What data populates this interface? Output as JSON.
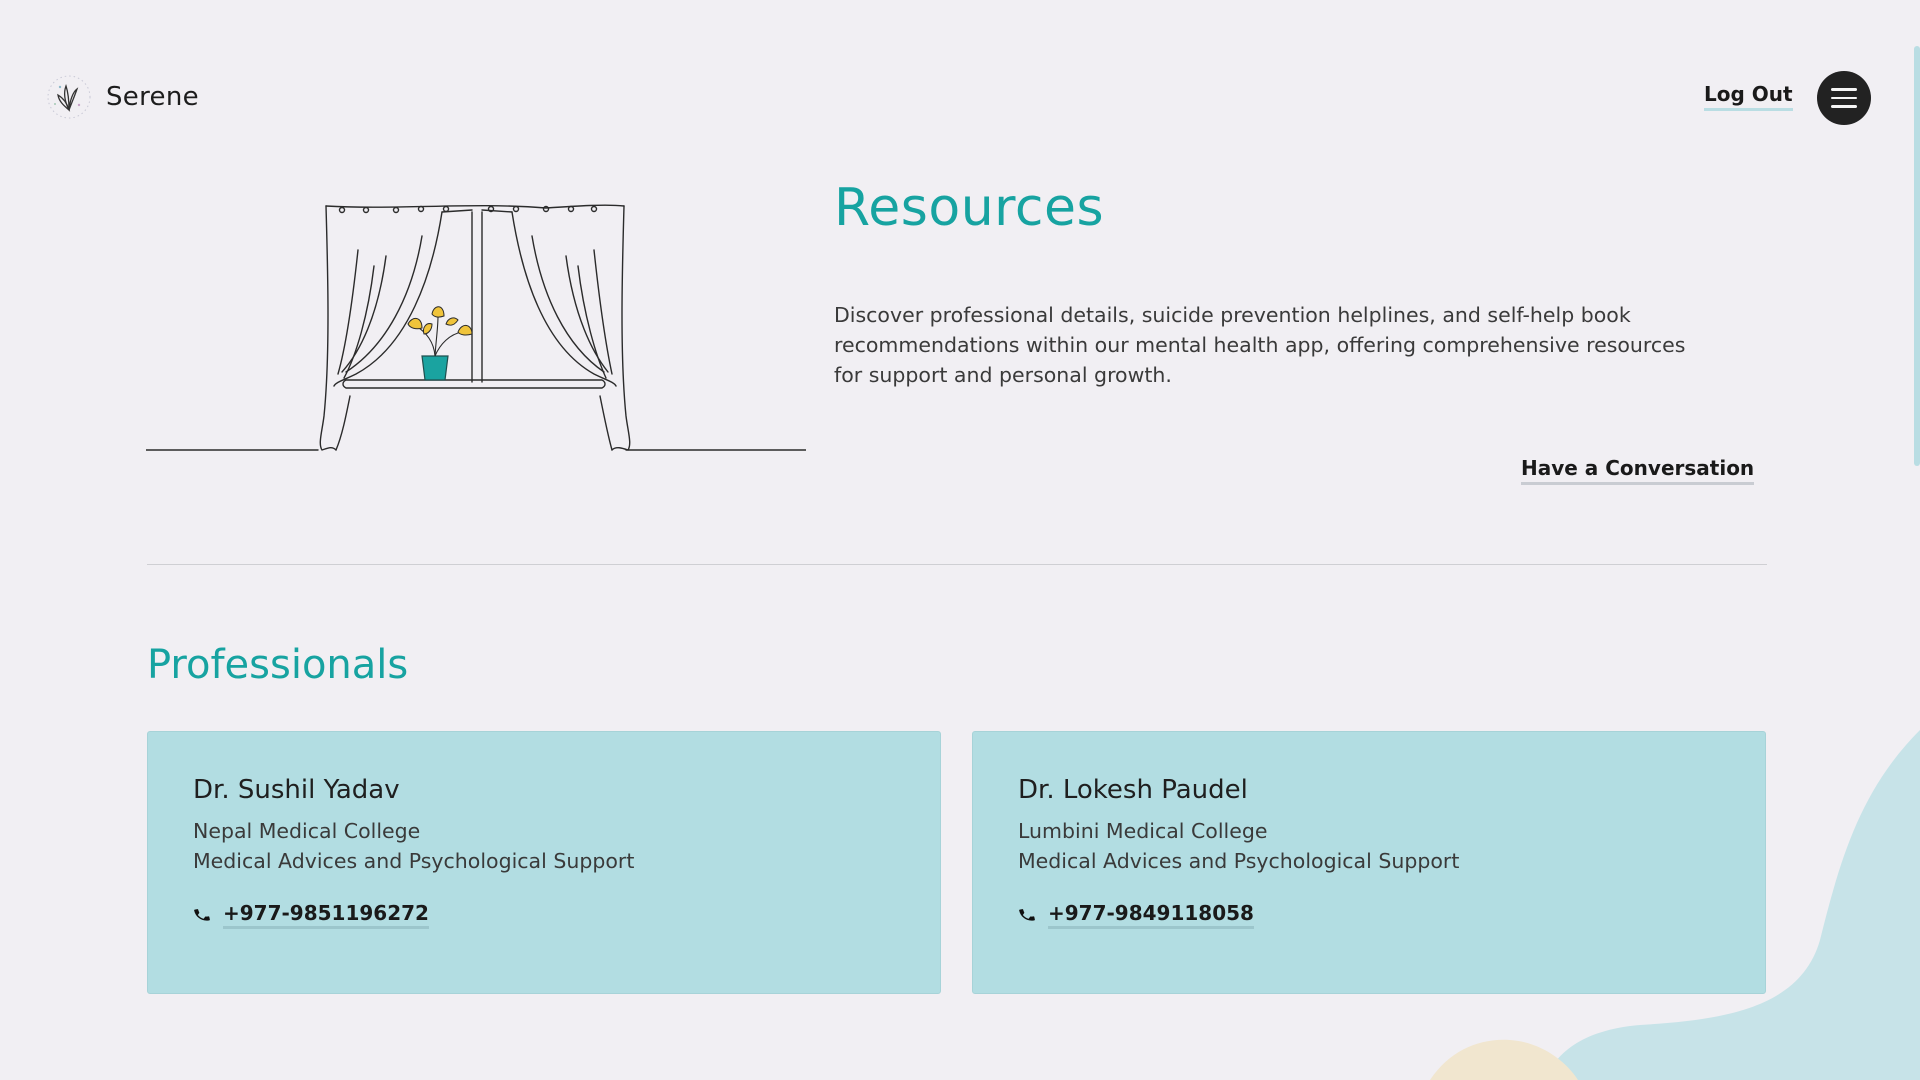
{
  "header": {
    "brand_name": "Serene",
    "logout_label": "Log Out",
    "menu_icon": "hamburger-icon"
  },
  "hero": {
    "title": "Resources",
    "description": "Discover professional details, suicide prevention helplines, and self-help book recommendations within our mental health app, offering comprehensive resources for support and personal growth.",
    "cta_label": "Have a Conversation",
    "illustration": "window-with-curtains-and-plant"
  },
  "professionals": {
    "title": "Professionals",
    "items": [
      {
        "name": "Dr. Sushil Yadav",
        "college": "Nepal Medical College",
        "service": "Medical Advices and Psychological Support",
        "phone": "+977-9851196272",
        "phone_icon": "phone-icon"
      },
      {
        "name": "Dr. Lokesh Paudel",
        "college": "Lumbini Medical College",
        "service": "Medical Advices and Psychological Support",
        "phone": "+977-9849118058",
        "phone_icon": "phone-icon"
      }
    ]
  },
  "colors": {
    "background": "#f1eff3",
    "accent_teal": "#17a3a1",
    "card_bg": "#b2dde2",
    "underline_teal": "#b9dde3",
    "dark_button": "#222222",
    "blob_blue": "#c7e3e8",
    "blob_sand": "#f1e6cf"
  }
}
